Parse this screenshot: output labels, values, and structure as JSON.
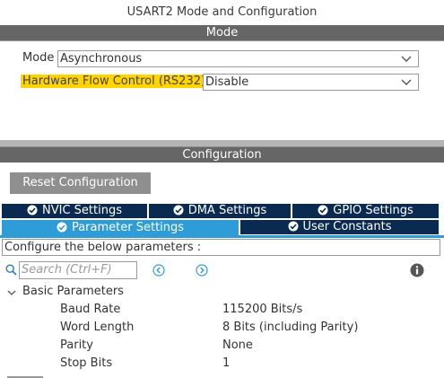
{
  "window": {
    "title": "USART2 Mode and Configuration"
  },
  "mode_section": {
    "header": "Mode",
    "mode_label": "Mode",
    "mode_value": "Asynchronous",
    "flow_label": "Hardware Flow Control (RS232)",
    "flow_value": "Disable"
  },
  "config_section": {
    "header": "Configuration",
    "reset_label": "Reset Configuration",
    "tabs_row1": [
      "NVIC Settings",
      "DMA Settings",
      "GPIO Settings"
    ],
    "tabs_row2": [
      "Parameter Settings",
      "User Constants"
    ],
    "active_tab": "Parameter Settings",
    "info_text": "Configure the below parameters :",
    "search_placeholder": "Search (Ctrl+F)",
    "group_label": "Basic Parameters",
    "params": [
      {
        "name": "Baud Rate",
        "value": "115200 Bits/s"
      },
      {
        "name": "Word Length",
        "value": "8 Bits (including Parity)"
      },
      {
        "name": "Parity",
        "value": "None"
      },
      {
        "name": "Stop Bits",
        "value": "1"
      }
    ]
  },
  "colors": {
    "band": "#666666",
    "tab_dark": "#0b2a52",
    "tab_active": "#2e9cd6",
    "highlight": "#ffd400",
    "nav_icon": "#2e9cd6"
  },
  "icons": [
    "check-circle-icon",
    "chevron-down-icon",
    "search-icon",
    "arrow-left-circle-icon",
    "arrow-right-circle-icon",
    "info-icon",
    "collapse-chevron-icon"
  ]
}
